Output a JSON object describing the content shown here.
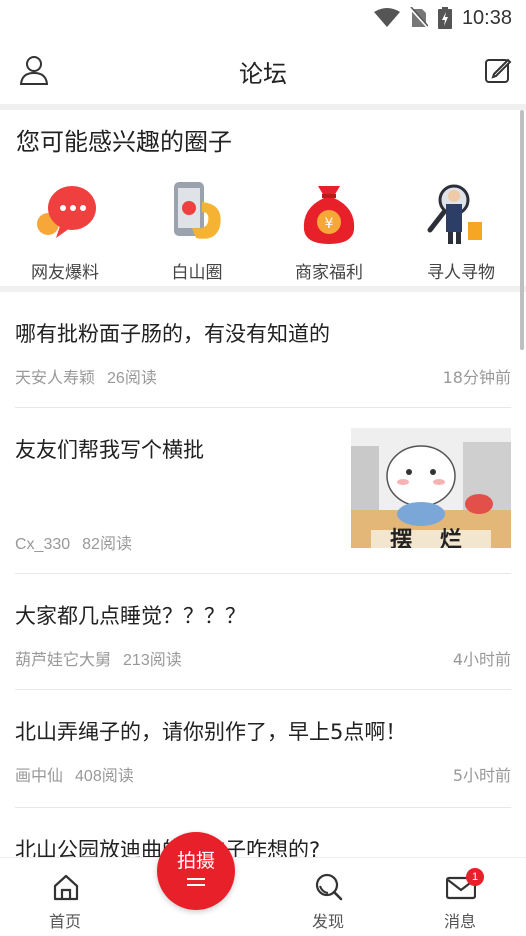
{
  "status_bar": {
    "time": "10:38"
  },
  "header": {
    "title": "论坛"
  },
  "circles": {
    "heading": "您可能感兴趣的圈子",
    "items": [
      {
        "label": "网友爆料",
        "icon": "chat-bubbles-icon"
      },
      {
        "label": "白山圈",
        "icon": "phone-hand-icon"
      },
      {
        "label": "商家福利",
        "icon": "money-bag-icon"
      },
      {
        "label": "寻人寻物",
        "icon": "magnifier-person-icon"
      }
    ]
  },
  "posts": [
    {
      "title": "哪有批粉面子肠的，有没有知道的",
      "author": "天安人寿颖",
      "reads": "26阅读",
      "time": "18分钟前"
    },
    {
      "title": "友友们帮我写个横批",
      "author": "Cx_330",
      "reads": "82阅读",
      "time": "",
      "thumb_text": "摆 烂"
    },
    {
      "title": "大家都几点睡觉？？？？",
      "author": "葫芦娃它大舅",
      "reads": "213阅读",
      "time": "4小时前"
    },
    {
      "title": "北山弄绳子的，请你别作了，早上5点啊！",
      "author": "画中仙",
      "reads": "408阅读",
      "time": "5小时前"
    },
    {
      "title": "北山公园放迪曲的，脑子咋想的?",
      "author": "",
      "reads": "",
      "time": ""
    }
  ],
  "tabbar": {
    "home": "首页",
    "shoot": "拍摄",
    "discover": "发现",
    "messages": "消息",
    "messages_badge": "1"
  },
  "colors": {
    "accent": "#e8202a"
  }
}
